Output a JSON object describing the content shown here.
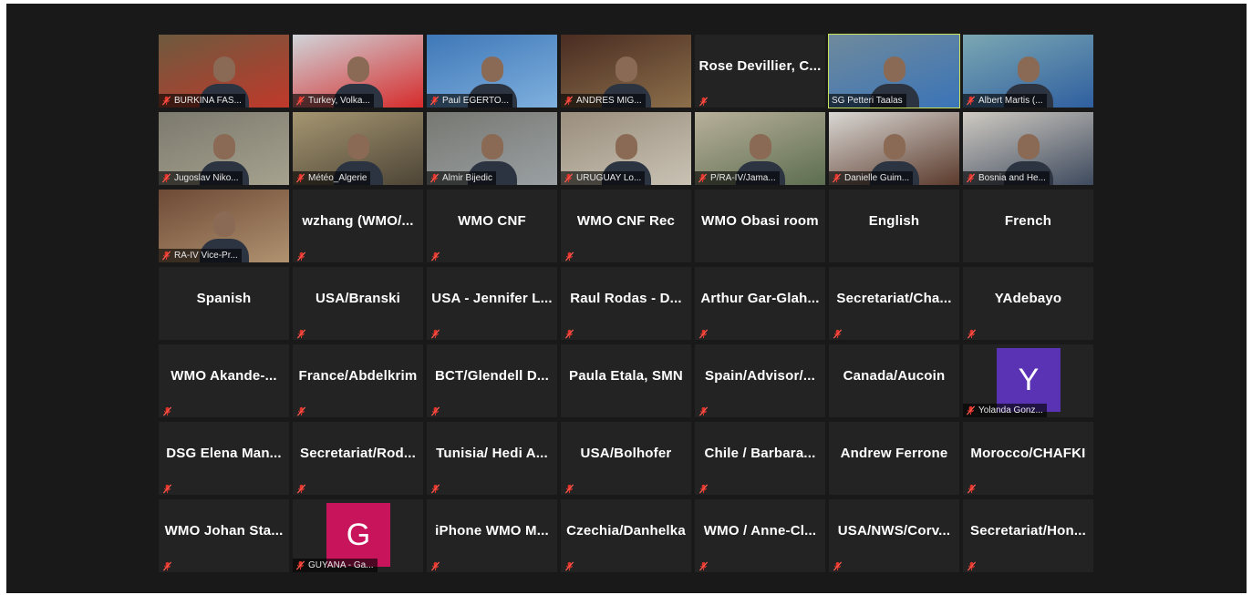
{
  "meeting": {
    "participants": [
      {
        "label": "BURKINA FAS...",
        "kind": "video",
        "bg": "#6d5a3e",
        "accent": "#c0392b",
        "muted": true
      },
      {
        "label": "Turkey, Volka...",
        "kind": "video",
        "bg": "#cfd4d9",
        "accent": "#d62b2b",
        "muted": true
      },
      {
        "label": "Paul EGERTO...",
        "kind": "video",
        "bg": "#3f78b8",
        "accent": "#7fb0de",
        "muted": true
      },
      {
        "label": "ANDRES MIG...",
        "kind": "video",
        "bg": "#4a2c22",
        "accent": "#8c6f4a",
        "muted": true
      },
      {
        "label": "Rose Devillier, C...",
        "kind": "text",
        "muted": true
      },
      {
        "label": "SG Petteri Taalas",
        "kind": "video",
        "bg": "#6f8a9c",
        "accent": "#3a74b8",
        "muted": false,
        "active": true
      },
      {
        "label": "Albert Martis (...",
        "kind": "video",
        "bg": "#7ba7b2",
        "accent": "#2f5fa0",
        "muted": true
      },
      {
        "label": "Jugoslav Niko...",
        "kind": "video",
        "bg": "#7c7a6e",
        "accent": "#a6a28f",
        "muted": true
      },
      {
        "label": "Météo_Algerie",
        "kind": "video",
        "bg": "#a59671",
        "accent": "#4d4436",
        "muted": true
      },
      {
        "label": "Almir Bijedic",
        "kind": "video",
        "bg": "#777872",
        "accent": "#9aa0a3",
        "muted": true
      },
      {
        "label": "URUGUAY Lo...",
        "kind": "video",
        "bg": "#9a8e7d",
        "accent": "#c9c2b4",
        "muted": true
      },
      {
        "label": "P/RA-IV/Jama...",
        "kind": "video",
        "bg": "#b8b09a",
        "accent": "#5c6d4f",
        "muted": true
      },
      {
        "label": "Danielle Guim...",
        "kind": "video",
        "bg": "#d9d7d3",
        "accent": "#5b3a2c",
        "muted": true
      },
      {
        "label": "Bosnia and He...",
        "kind": "video",
        "bg": "#cfcac2",
        "accent": "#3e4a5e",
        "muted": true
      },
      {
        "label": "RA-IV Vice-Pr...",
        "kind": "video",
        "bg": "#6e4a36",
        "accent": "#b09270",
        "muted": true
      },
      {
        "label": "wzhang  (WMO/...",
        "kind": "text",
        "muted": true
      },
      {
        "label": "WMO CNF",
        "kind": "text",
        "muted": true
      },
      {
        "label": "WMO CNF Rec",
        "kind": "text",
        "muted": true
      },
      {
        "label": "WMO Obasi room",
        "kind": "text",
        "muted": false
      },
      {
        "label": "English",
        "kind": "text",
        "muted": false
      },
      {
        "label": "French",
        "kind": "text",
        "muted": false
      },
      {
        "label": "Spanish",
        "kind": "text",
        "muted": false
      },
      {
        "label": "USA/Branski",
        "kind": "text",
        "muted": true
      },
      {
        "label": "USA - Jennifer L...",
        "kind": "text",
        "muted": true
      },
      {
        "label": "Raul Rodas - D...",
        "kind": "text",
        "muted": true
      },
      {
        "label": "Arthur Gar-Glah...",
        "kind": "text",
        "muted": true
      },
      {
        "label": "Secretariat/Cha...",
        "kind": "text",
        "muted": true
      },
      {
        "label": "YAdebayo",
        "kind": "text",
        "muted": true
      },
      {
        "label": "WMO  Akande-...",
        "kind": "text",
        "muted": true
      },
      {
        "label": "France/Abdelkrim",
        "kind": "text",
        "muted": true
      },
      {
        "label": "BCT/Glendell  D...",
        "kind": "text",
        "muted": true
      },
      {
        "label": "Paula Etala, SMN",
        "kind": "text",
        "muted": false
      },
      {
        "label": "Spain/Advisor/...",
        "kind": "text",
        "muted": true
      },
      {
        "label": "Canada/Aucoin",
        "kind": "text",
        "muted": false
      },
      {
        "label": "Yolanda Gonz...",
        "kind": "avatar",
        "initial": "Y",
        "bg": "#5a33b5",
        "muted": true
      },
      {
        "label": "DSG Elena Man...",
        "kind": "text",
        "muted": true
      },
      {
        "label": "Secretariat/Rod...",
        "kind": "text",
        "muted": true
      },
      {
        "label": "Tunisia/  Hedi A...",
        "kind": "text",
        "muted": true
      },
      {
        "label": "USA/Bolhofer",
        "kind": "text",
        "muted": true
      },
      {
        "label": "Chile / Barbara...",
        "kind": "text",
        "muted": true
      },
      {
        "label": "Andrew Ferrone",
        "kind": "text",
        "muted": false
      },
      {
        "label": "Morocco/CHAFKI",
        "kind": "text",
        "muted": true
      },
      {
        "label": "WMO Johan Sta...",
        "kind": "text",
        "muted": true
      },
      {
        "label": "GUYANA - Ga...",
        "kind": "avatar",
        "initial": "G",
        "bg": "#c8145a",
        "muted": true
      },
      {
        "label": "iPhone WMO M...",
        "kind": "text",
        "muted": true
      },
      {
        "label": "Czechia/Danhelka",
        "kind": "text",
        "muted": true
      },
      {
        "label": "WMO  /  Anne-Cl...",
        "kind": "text",
        "muted": true
      },
      {
        "label": "USA/NWS/Corv...",
        "kind": "text",
        "muted": true
      },
      {
        "label": "Secretariat/Hon...",
        "kind": "text",
        "muted": true
      }
    ]
  },
  "icons": {
    "muted": "muted-microphone-icon"
  },
  "colors": {
    "window": "#191919",
    "tile": "#232323",
    "active_speaker_border": "#c9e35b",
    "mute_icon": "#e0342b"
  }
}
